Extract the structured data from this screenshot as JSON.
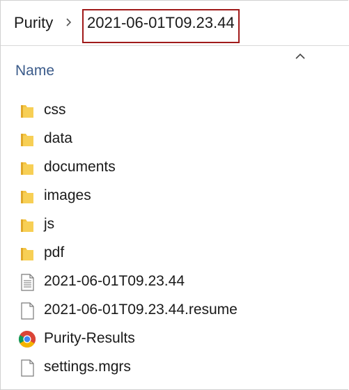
{
  "breadcrumb": {
    "root": "Purity",
    "current": "2021-06-01T09.23.44"
  },
  "header": {
    "name_column": "Name",
    "sort_icon": "chevron-up-icon"
  },
  "files": [
    {
      "name": "css",
      "type": "folder",
      "icon": "folder-icon"
    },
    {
      "name": "data",
      "type": "folder",
      "icon": "folder-icon"
    },
    {
      "name": "documents",
      "type": "folder",
      "icon": "folder-icon"
    },
    {
      "name": "images",
      "type": "folder",
      "icon": "folder-icon"
    },
    {
      "name": "js",
      "type": "folder",
      "icon": "folder-icon"
    },
    {
      "name": "pdf",
      "type": "folder",
      "icon": "folder-icon"
    },
    {
      "name": "2021-06-01T09.23.44",
      "type": "text-file",
      "icon": "text-file-icon"
    },
    {
      "name": "2021-06-01T09.23.44.resume",
      "type": "file",
      "icon": "blank-file-icon"
    },
    {
      "name": "Purity-Results",
      "type": "chrome-html",
      "icon": "chrome-icon"
    },
    {
      "name": "settings.mgrs",
      "type": "file",
      "icon": "blank-file-icon"
    }
  ],
  "colors": {
    "highlight_border": "#a01a1a",
    "header_text": "#3b5b8a",
    "folder_yellow": "#f4c542"
  }
}
